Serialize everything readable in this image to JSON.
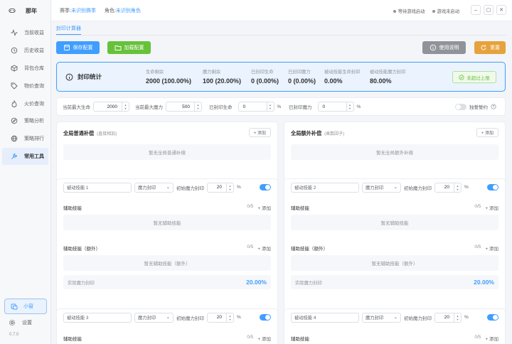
{
  "app": {
    "name": "那年",
    "version": "0.7.0"
  },
  "sidebar": {
    "items": [
      {
        "label": "当前收益",
        "icon": "activity-icon"
      },
      {
        "label": "历史收益",
        "icon": "history-icon"
      },
      {
        "label": "背包仓库",
        "icon": "box-icon"
      },
      {
        "label": "物价查询",
        "icon": "tag-icon"
      },
      {
        "label": "火价查询",
        "icon": "flame-icon"
      },
      {
        "label": "策略分析",
        "icon": "compass-icon"
      },
      {
        "label": "策略排行",
        "icon": "globe-icon"
      },
      {
        "label": "常用工具",
        "icon": "wrench-icon",
        "active": true
      }
    ],
    "mini_label": "小窗",
    "settings_label": "设置"
  },
  "header": {
    "season_label": "赛季:",
    "season_value": "未识别赛季",
    "role_label": "角色:",
    "role_value": "未识别角色",
    "status1": "等待游戏启动",
    "status2": "游戏未启动",
    "win_min": "–",
    "win_max": "▢",
    "win_close": "✕"
  },
  "tab": "封印计算器",
  "toolbar": {
    "save": "保存配置",
    "load": "加载配置",
    "help": "使用说明",
    "reset": "重置",
    "colors": {
      "save": "#409eff",
      "load": "#67c23a",
      "help": "#909399",
      "reset": "#e6a23c"
    }
  },
  "stats": {
    "title": "封印统计",
    "items": [
      {
        "k": "生命剩余",
        "v": "2000 (100.00%)"
      },
      {
        "k": "魔力剩余",
        "v": "100 (20.00%)"
      },
      {
        "k": "已封印生命",
        "v": "0 (0.00%)"
      },
      {
        "k": "已封印魔力",
        "v": "0 (0.00%)"
      },
      {
        "k": "被动技能生命封印",
        "v": "0.00%"
      },
      {
        "k": "被动技能魔力封印",
        "v": "80.00%"
      }
    ],
    "limit": "未超过上限"
  },
  "controls": {
    "max_hp_label": "当前最大生命",
    "max_hp": "2000",
    "max_mp_label": "当前最大魔力",
    "max_mp": "500",
    "sealed_hp_label": "已封印生命",
    "sealed_hp": "0",
    "sealed_mp_label": "已封印魔力",
    "sealed_mp": "0",
    "pct": "%",
    "oath_label": "独誓誓约"
  },
  "global_normal": {
    "title": "全局普通补偿",
    "sub": "(直接相加)",
    "add": "+ 添加",
    "empty": "暂无全局普通补偿"
  },
  "global_extra": {
    "title": "全局额外补偿",
    "sub": "(乘数因子)",
    "add": "+ 添加",
    "empty": "暂无全局额外补偿"
  },
  "skills": [
    {
      "name": "被动技能 1",
      "type": "魔力封印",
      "init_label": "初始魔力封印",
      "init": "20",
      "pct": "%",
      "aux_label": "辅助技能",
      "aux_count": "0/5",
      "add": "+ 添加",
      "aux_empty": "暂无辅助技能",
      "extra_label": "辅助技能（额外）",
      "extra_count": "0/5",
      "extra_empty": "暂无辅助技能（额外）",
      "actual_label": "实际魔力封印",
      "actual": "20.00%"
    },
    {
      "name": "被动技能 2",
      "type": "魔力封印",
      "init_label": "初始魔力封印",
      "init": "20",
      "pct": "%",
      "aux_label": "辅助技能",
      "aux_count": "0/5",
      "add": "+ 添加",
      "aux_empty": "暂无辅助技能",
      "extra_label": "辅助技能（额外）",
      "extra_count": "0/5",
      "extra_empty": "暂无辅助技能（额外）",
      "actual_label": "实际魔力封印",
      "actual": "20.00%"
    },
    {
      "name": "被动技能 3",
      "type": "魔力封印",
      "init_label": "初始魔力封印",
      "init": "20",
      "pct": "%",
      "aux_label": "辅助技能",
      "aux_count": "0/5",
      "add": "+ 添加"
    },
    {
      "name": "被动技能 4",
      "type": "魔力封印",
      "init_label": "初始魔力封印",
      "init": "20",
      "pct": "%",
      "aux_label": "辅助技能",
      "aux_count": "0/5",
      "add": "+ 添加"
    }
  ]
}
